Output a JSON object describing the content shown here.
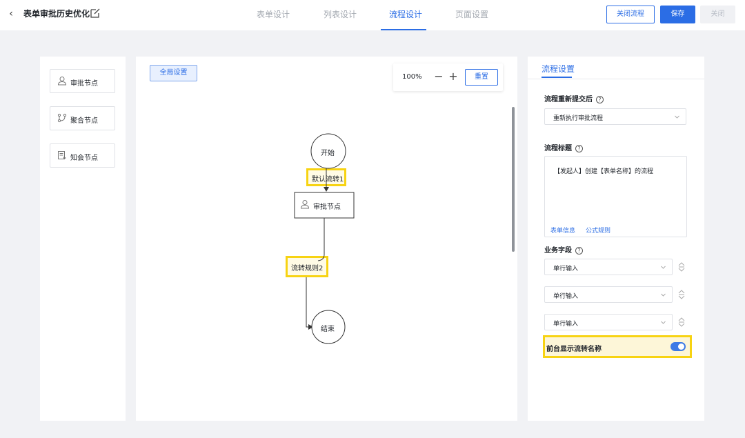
{
  "header": {
    "title": "表单审批历史优化",
    "tabs": [
      {
        "label": "表单设计"
      },
      {
        "label": "列表设计"
      },
      {
        "label": "流程设计"
      },
      {
        "label": "页面设置"
      }
    ],
    "active_tab": "流程设计",
    "close_flow_label": "关闭流程",
    "save_label": "保存",
    "close_label": "关闭"
  },
  "node_palette": {
    "items": [
      {
        "label": "审批节点",
        "icon": "user-icon"
      },
      {
        "label": "聚合节点",
        "icon": "merge-icon"
      },
      {
        "label": "知会节点",
        "icon": "notify-icon"
      }
    ]
  },
  "canvas": {
    "global_settings_label": "全局设置",
    "zoom_level": "100%",
    "zoom_out_symbol": "−",
    "zoom_in_symbol": "+",
    "reset_label": "重置",
    "flow": {
      "start_label": "开始",
      "edge1_label": "默认流转1",
      "approval_node_label": "审批节点",
      "edge2_label": "流转规则2",
      "end_label": "结束"
    }
  },
  "settings": {
    "tab_label": "流程设置",
    "resubmit": {
      "label": "流程重新提交后",
      "value": "重新执行审批流程"
    },
    "flow_title": {
      "label": "流程标题",
      "value": "【发起人】创建【表单名称】的流程",
      "link_form_info": "表单信息",
      "link_formula": "公式规则"
    },
    "business_fields": {
      "label": "业务字段",
      "fields": [
        "单行输入",
        "单行输入",
        "单行输入"
      ]
    },
    "show_flow_name": {
      "label": "前台显示流转名称",
      "enabled": true
    }
  },
  "colors": {
    "accent": "#2b6de5",
    "highlight": "#f7d312",
    "toggle_on": "#3d7be6"
  }
}
